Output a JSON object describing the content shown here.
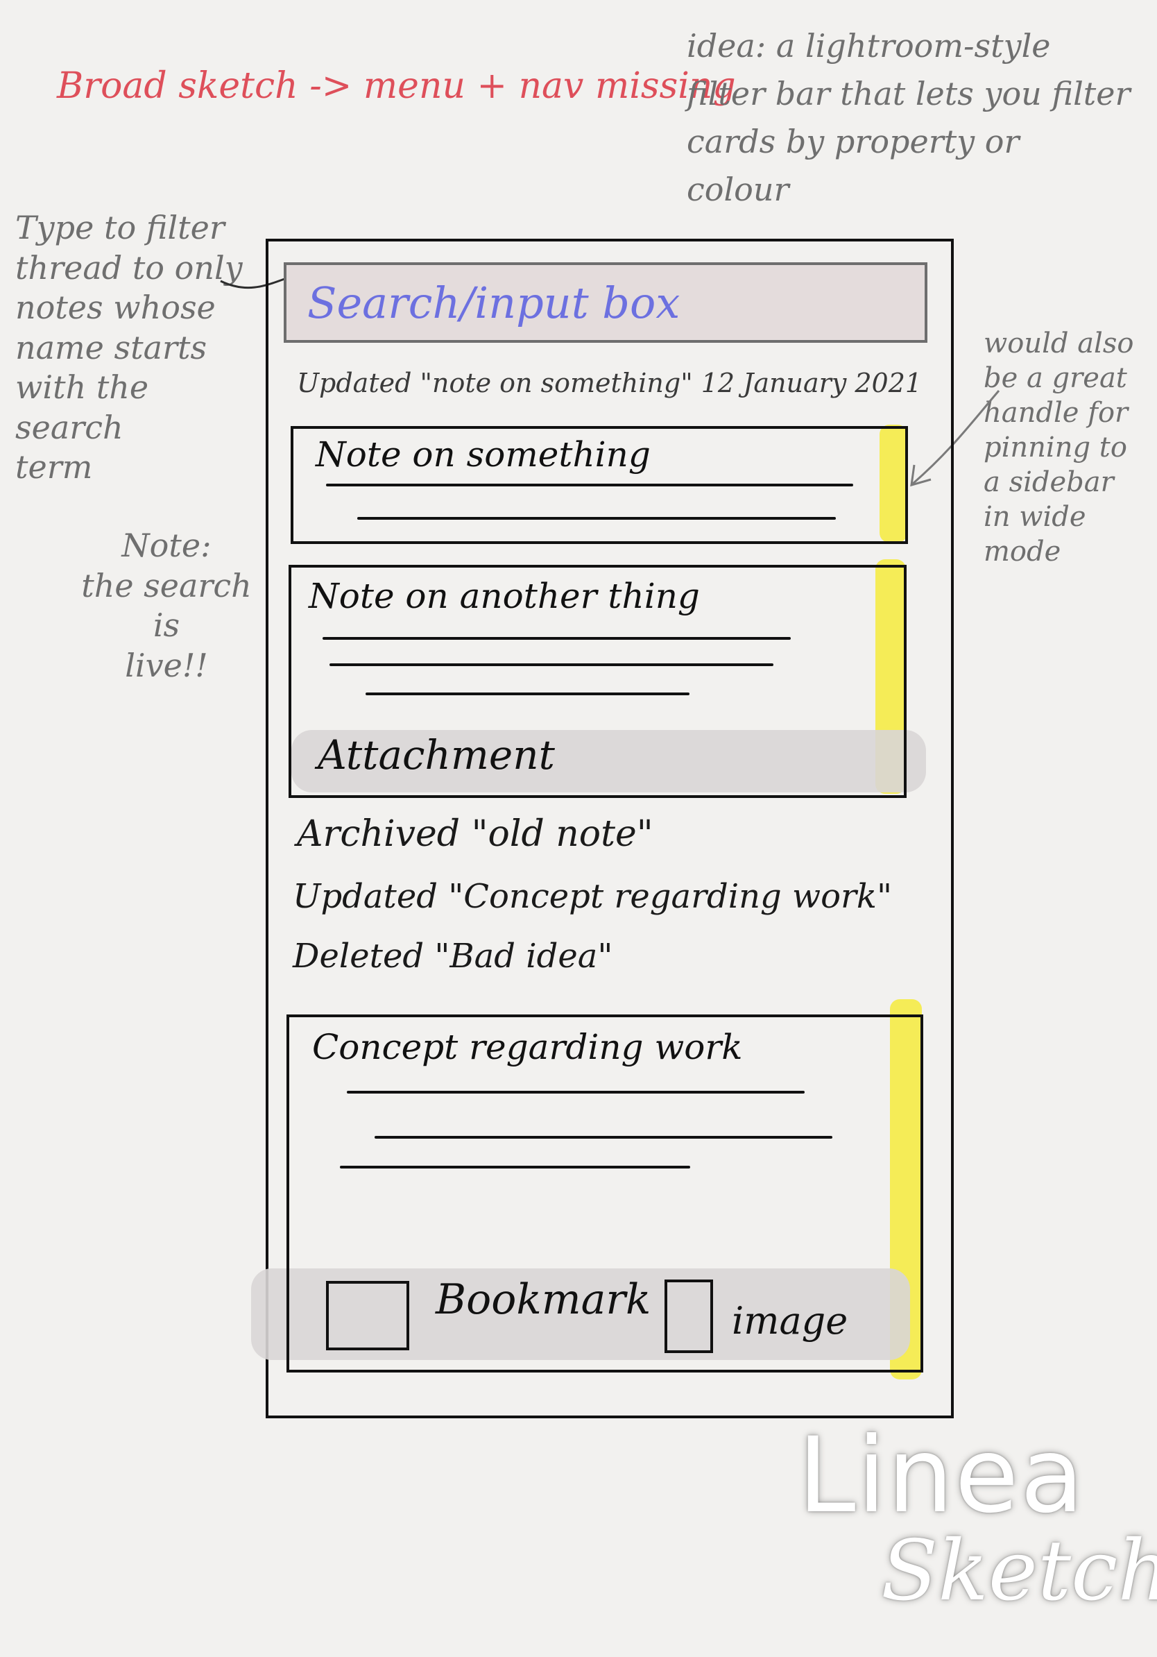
{
  "annotations": {
    "top_left": "Broad sketch -> menu + nav missing",
    "top_right": "idea: a lightroom-style\nfilter bar that lets you filter\ncards by property or colour",
    "left_filter": "Type to filter\nthread to only\nnotes whose\nname starts\nwith the search\nterm",
    "left_live": "Note:\nthe search is\nlive!!",
    "right_handle": "would also\nbe a great\nhandle for\npinning to\na sidebar\nin wide\nmode"
  },
  "search": {
    "placeholder": "Search/input box"
  },
  "feed": {
    "top_event": "Updated  \"note on something\"   12 January 2021",
    "events": [
      "Archived  \"old note\"",
      "Updated  \"Concept regarding work\"",
      "Deleted   \"Bad idea\""
    ]
  },
  "cards": [
    {
      "title": "Note on something"
    },
    {
      "title": "Note on another thing",
      "attachment": "Attachment"
    },
    {
      "title": "Concept regarding work",
      "options": [
        "Bookmark",
        "image"
      ]
    }
  ],
  "colors": {
    "highlight": "#f5ec4a",
    "search_text": "#6c70e0",
    "annotation_red": "#de4f5a"
  },
  "logo": {
    "line1": "Linea",
    "line2": "Sketch"
  }
}
